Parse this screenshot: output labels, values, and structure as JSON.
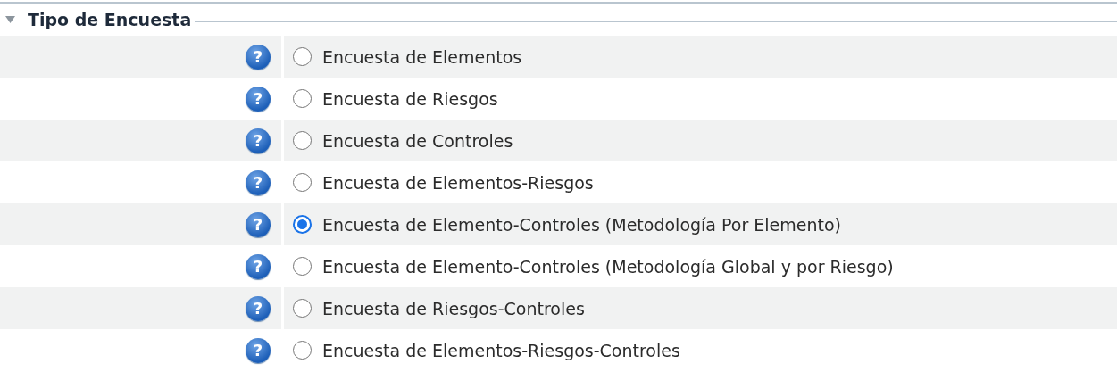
{
  "section": {
    "title": "Tipo de Encuesta",
    "expanded": true
  },
  "options": [
    {
      "help": "?",
      "label": "Encuesta de Elementos",
      "selected": false
    },
    {
      "help": "?",
      "label": "Encuesta de Riesgos",
      "selected": false
    },
    {
      "help": "?",
      "label": "Encuesta de Controles",
      "selected": false
    },
    {
      "help": "?",
      "label": "Encuesta de Elementos-Riesgos",
      "selected": false
    },
    {
      "help": "?",
      "label": "Encuesta de Elemento-Controles (Metodología Por Elemento)",
      "selected": true
    },
    {
      "help": "?",
      "label": "Encuesta de Elemento-Controles (Metodología Global y por Riesgo)",
      "selected": false
    },
    {
      "help": "?",
      "label": "Encuesta de Riesgos-Controles",
      "selected": false
    },
    {
      "help": "?",
      "label": "Encuesta de Elementos-Riesgos-Controles",
      "selected": false
    }
  ]
}
